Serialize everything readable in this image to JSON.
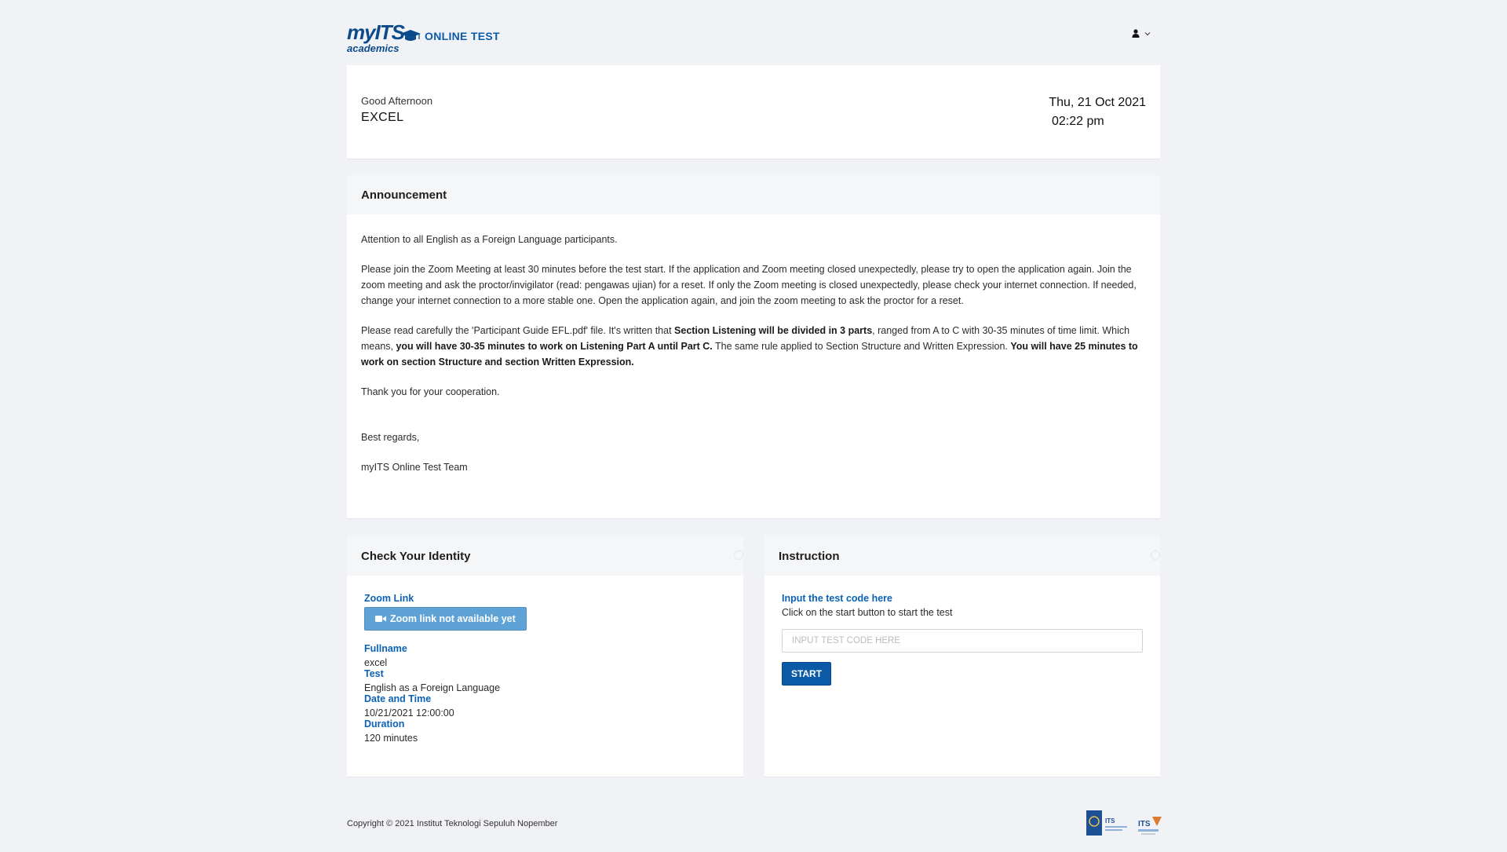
{
  "header": {
    "logo_primary": "myITS",
    "logo_secondary": "academics",
    "app_title": "ONLINE TEST",
    "user_icon": "user-icon",
    "chevron_icon": "chevron-down-icon"
  },
  "greeting": {
    "salutation": "Good Afternoon",
    "username": "EXCEL",
    "date": "Thu, 21 Oct 2021",
    "time": "02:22 pm"
  },
  "announcement": {
    "title": "Announcement",
    "p1": "Attention to all English as a Foreign Language participants.",
    "p2": "Please join the Zoom Meeting at least 30 minutes before the test start. If the application and Zoom meeting closed unexpectedly, please try to open the application again. Join the zoom meeting and ask the proctor/invigilator (read: pengawas ujian) for a reset. If only the Zoom meeting is closed unexpectedly, please check your internet connection. If needed, change your internet connection to a more stable one. Open the application again, and join the zoom meeting to ask the proctor for a reset.",
    "p3_a": "Please read carefully the 'Participant Guide EFL.pdf' file. It's written that ",
    "p3_b": "Section Listening will be divided in 3 parts",
    "p3_c": ", ranged from A to C with 30-35 minutes of time limit. Which means, ",
    "p3_d": "you will have 30-35 minutes to work on Listening Part A until Part C.",
    "p3_e": " The same rule applied to Section Structure and Written Expression. ",
    "p3_f": "You will have 25 minutes to work on section Structure and section Written Expression.",
    "p4": "Thank you for your cooperation.",
    "p5": "Best regards,",
    "p6": "myITS Online Test Team"
  },
  "identity": {
    "title": "Check Your Identity",
    "zoom_label": "Zoom Link",
    "zoom_button": "Zoom link not available yet",
    "fullname_label": "Fullname",
    "fullname_value": "excel",
    "test_label": "Test",
    "test_value": "English as a Foreign Language",
    "datetime_label": "Date and Time",
    "datetime_value": "10/21/2021 12:00:00",
    "duration_label": "Duration",
    "duration_value": "120 minutes"
  },
  "instruction": {
    "title": "Instruction",
    "input_label": "Input the test code here",
    "hint": "Click on the start button to start the test",
    "placeholder": "INPUT TEST CODE HERE",
    "start_label": "START"
  },
  "footer": {
    "copyright": "Copyright © 2021 Institut Teknologi Sepuluh Nopember",
    "logo1_text": "ITS",
    "logo2_text": "ITS"
  },
  "colors": {
    "brand_blue": "#0b5bab",
    "link_blue": "#0b62b5",
    "button_blue": "#0a5aa8",
    "disabled_blue": "#5fa3d6",
    "page_bg": "#f1f2f6"
  }
}
